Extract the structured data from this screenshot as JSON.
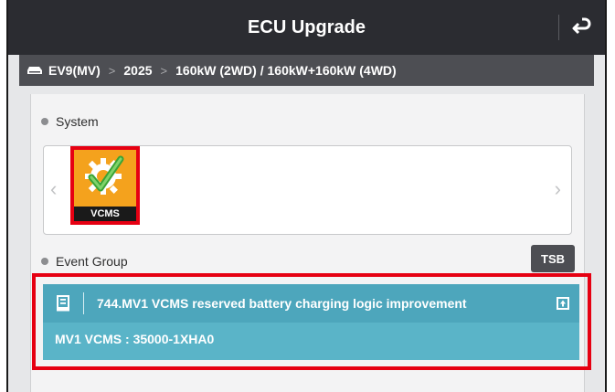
{
  "header": {
    "title": "ECU Upgrade",
    "back_icon": "return-arrow-icon"
  },
  "breadcrumb": {
    "icon": "car-icon",
    "items": [
      "EV9(MV)",
      "2025",
      "160kW (2WD) / 160kW+160kW (4WD)"
    ],
    "separator": ">"
  },
  "system": {
    "heading": "System",
    "items": [
      {
        "label": "VCMS",
        "icon": "gear-checkmark-icon"
      }
    ],
    "nav": {
      "prev": "‹",
      "next": "›"
    }
  },
  "event_group": {
    "heading": "Event Group",
    "tsb_label": "TSB",
    "events": [
      {
        "title": "744.MV1 VCMS reserved battery charging logic improvement",
        "detail": "MV1 VCMS : 35000-1XHA0",
        "icon": "document-icon",
        "action_icon": "expand-icon"
      }
    ]
  },
  "colors": {
    "header_bg": "#2b2c31",
    "breadcrumb_bg": "#4d4e53",
    "event_bg": "#5ab4c8",
    "highlight": "#e60012",
    "vcms_tile": "#f4a21d"
  }
}
